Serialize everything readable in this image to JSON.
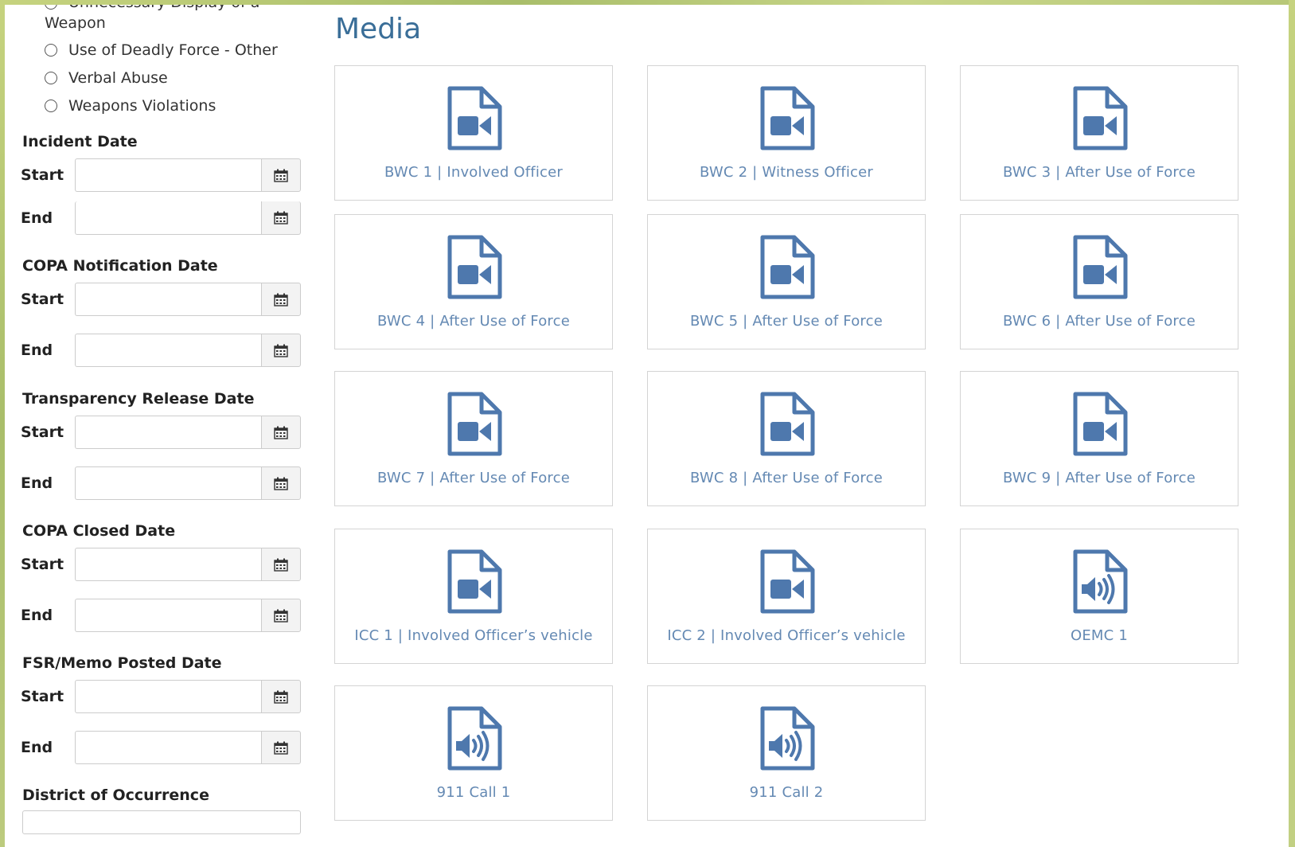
{
  "sidebar": {
    "cutoff_line1": "Unnecessary Display of a",
    "cutoff_line2": "Weapon",
    "radios": [
      {
        "label": "Use of Deadly Force - Other"
      },
      {
        "label": "Verbal Abuse"
      },
      {
        "label": "Weapons Violations"
      }
    ],
    "date_groups": [
      {
        "title": "Incident Date",
        "start_label": "Start",
        "end_label": "End",
        "start_value": "",
        "end_value": ""
      },
      {
        "title": "COPA Notification Date",
        "start_label": "Start",
        "end_label": "End",
        "start_value": "",
        "end_value": ""
      },
      {
        "title": "Transparency Release Date",
        "start_label": "Start",
        "end_label": "End",
        "start_value": "",
        "end_value": ""
      },
      {
        "title": "COPA Closed Date",
        "start_label": "Start",
        "end_label": "End",
        "start_value": "",
        "end_value": ""
      },
      {
        "title": "FSR/Memo Posted Date",
        "start_label": "Start",
        "end_label": "End",
        "start_value": "",
        "end_value": ""
      }
    ],
    "district_title": "District of Occurrence"
  },
  "media": {
    "title": "Media",
    "items": [
      {
        "label": "BWC 1 | Involved Officer",
        "icon": "video-file-icon"
      },
      {
        "label": "BWC 2 | Witness Officer",
        "icon": "video-file-icon"
      },
      {
        "label": "BWC 3 | After Use of Force",
        "icon": "video-file-icon"
      },
      {
        "label": "BWC 4 | After Use of Force",
        "icon": "video-file-icon"
      },
      {
        "label": "BWC 5 | After Use of Force",
        "icon": "video-file-icon"
      },
      {
        "label": "BWC 6 | After Use of Force",
        "icon": "video-file-icon"
      },
      {
        "label": "BWC 7 | After Use of Force",
        "icon": "video-file-icon"
      },
      {
        "label": "BWC 8 | After Use of Force",
        "icon": "video-file-icon"
      },
      {
        "label": "BWC 9 | After Use of Force",
        "icon": "video-file-icon"
      },
      {
        "label": "ICC 1 | Involved Officer’s vehicle",
        "icon": "video-file-icon"
      },
      {
        "label": "ICC 2 | Involved Officer’s vehicle",
        "icon": "video-file-icon"
      },
      {
        "label": "OEMC 1",
        "icon": "audio-file-icon"
      },
      {
        "label": "911 Call 1",
        "icon": "audio-file-icon"
      },
      {
        "label": "911 Call 2",
        "icon": "audio-file-icon"
      }
    ]
  },
  "colors": {
    "accent": "#3a6e98",
    "icon": "#4e78ad",
    "tile_label": "#6489b3",
    "frame": "#b9c98a"
  }
}
